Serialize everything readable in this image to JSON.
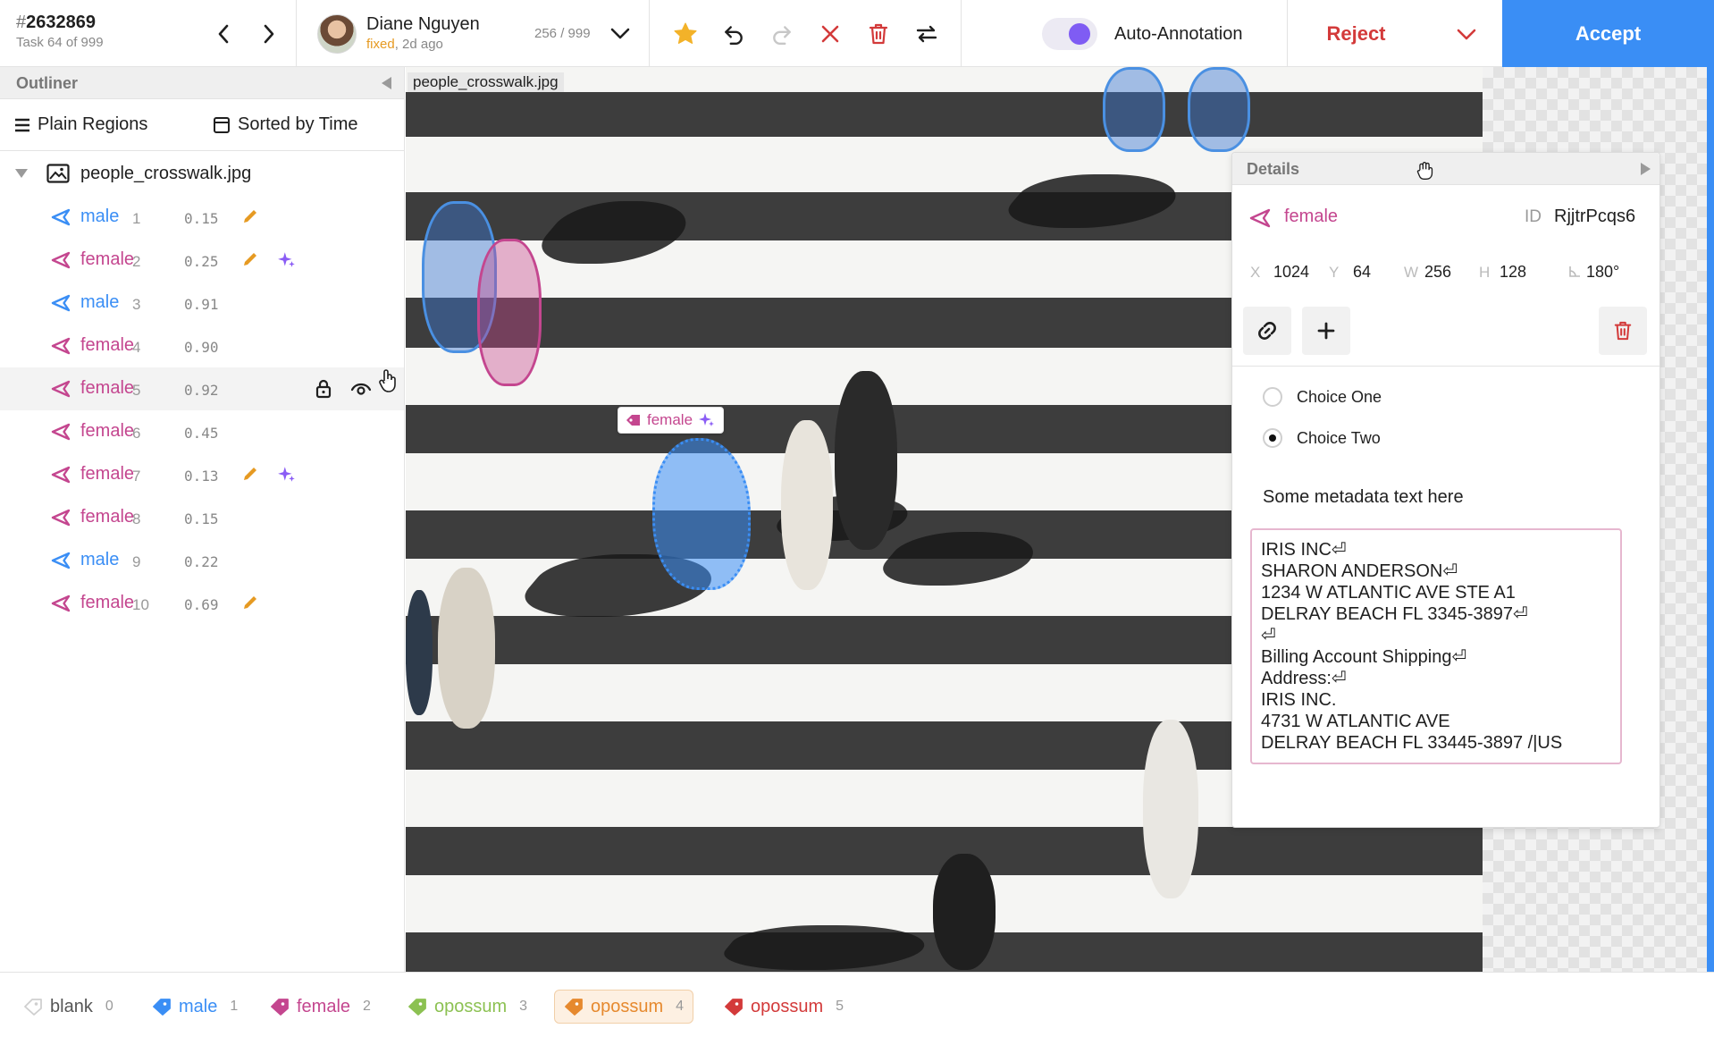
{
  "task": {
    "hash": "#",
    "id": "2632869",
    "subtitle": "Task 64 of 999"
  },
  "user": {
    "name": "Diane Nguyen",
    "status": "fixed",
    "time": ", 2d ago",
    "counter": "256 / 999"
  },
  "toolbar": {
    "auto_annotation_label": "Auto-Annotation",
    "auto_annotation_on": true,
    "reject_label": "Reject",
    "accept_label": "Accept",
    "icons": [
      "star-icon",
      "undo-icon",
      "redo-icon",
      "close-icon",
      "trash-icon",
      "swap-icon"
    ]
  },
  "outliner": {
    "title": "Outliner",
    "group_label": "Plain Regions",
    "sort_label": "Sorted by Time",
    "root": "people_crosswalk.jpg",
    "regions": [
      {
        "label": "male",
        "index": "1",
        "score": "0.15",
        "pencil": true,
        "sparkle": false
      },
      {
        "label": "female",
        "index": "2",
        "score": "0.25",
        "pencil": true,
        "sparkle": true
      },
      {
        "label": "male",
        "index": "3",
        "score": "0.91",
        "pencil": false,
        "sparkle": false
      },
      {
        "label": "female",
        "index": "4",
        "score": "0.90",
        "pencil": false,
        "sparkle": false
      },
      {
        "label": "female",
        "index": "5",
        "score": "0.92",
        "pencil": false,
        "sparkle": false,
        "hover": true
      },
      {
        "label": "female",
        "index": "6",
        "score": "0.45",
        "pencil": false,
        "sparkle": false
      },
      {
        "label": "female",
        "index": "7",
        "score": "0.13",
        "pencil": true,
        "sparkle": true
      },
      {
        "label": "female",
        "index": "8",
        "score": "0.15",
        "pencil": false,
        "sparkle": false
      },
      {
        "label": "male",
        "index": "9",
        "score": "0.22",
        "pencil": false,
        "sparkle": false
      },
      {
        "label": "female",
        "index": "10",
        "score": "0.69",
        "pencil": true,
        "sparkle": false
      }
    ]
  },
  "canvas": {
    "filename": "people_crosswalk.jpg",
    "region_tag": "female"
  },
  "details": {
    "title": "Details",
    "label": "female",
    "id_label": "ID",
    "id": "RjjtrPcqs6",
    "coords": {
      "x_label": "X",
      "x": "1024",
      "y_label": "Y",
      "y": "64",
      "w_label": "W",
      "w": "256",
      "h_label": "H",
      "h": "128",
      "angle": "180°"
    },
    "choices": [
      {
        "label": "Choice One",
        "selected": false
      },
      {
        "label": "Choice Two",
        "selected": true
      }
    ],
    "meta_text": "Some metadata text here",
    "textarea_value": "IRIS INC⏎\nSHARON ANDERSON⏎\n1234 W ATLANTIC AVE STE A1\nDELRAY BEACH FL 3345-3897⏎\n⏎\nBilling Account Shipping⏎\nAddress:⏎\nIRIS INC.\n4731 W ATLANTIC AVE\nDELRAY BEACH FL 33445-3897 /|US"
  },
  "labels": [
    {
      "name": "blank",
      "hotkey": "0",
      "color": "#cfcfcf",
      "text_color": "#555555"
    },
    {
      "name": "male",
      "hotkey": "1",
      "color": "#3a8ef5",
      "text_color": "#3a8ef5"
    },
    {
      "name": "female",
      "hotkey": "2",
      "color": "#c4468f",
      "text_color": "#c4468f"
    },
    {
      "name": "opossum",
      "hotkey": "3",
      "color": "#8cc152",
      "text_color": "#8cc152"
    },
    {
      "name": "opossum",
      "hotkey": "4",
      "color": "#e6892e",
      "text_color": "#e6892e",
      "active": true
    },
    {
      "name": "opossum",
      "hotkey": "5",
      "color": "#d33a3a",
      "text_color": "#d33a3a"
    }
  ],
  "colors": {
    "accent": "#3a8ef5",
    "male": "#3a8ef5",
    "female": "#c4468f",
    "reject": "#d33a3a",
    "toggle": "#7f5cf3"
  }
}
